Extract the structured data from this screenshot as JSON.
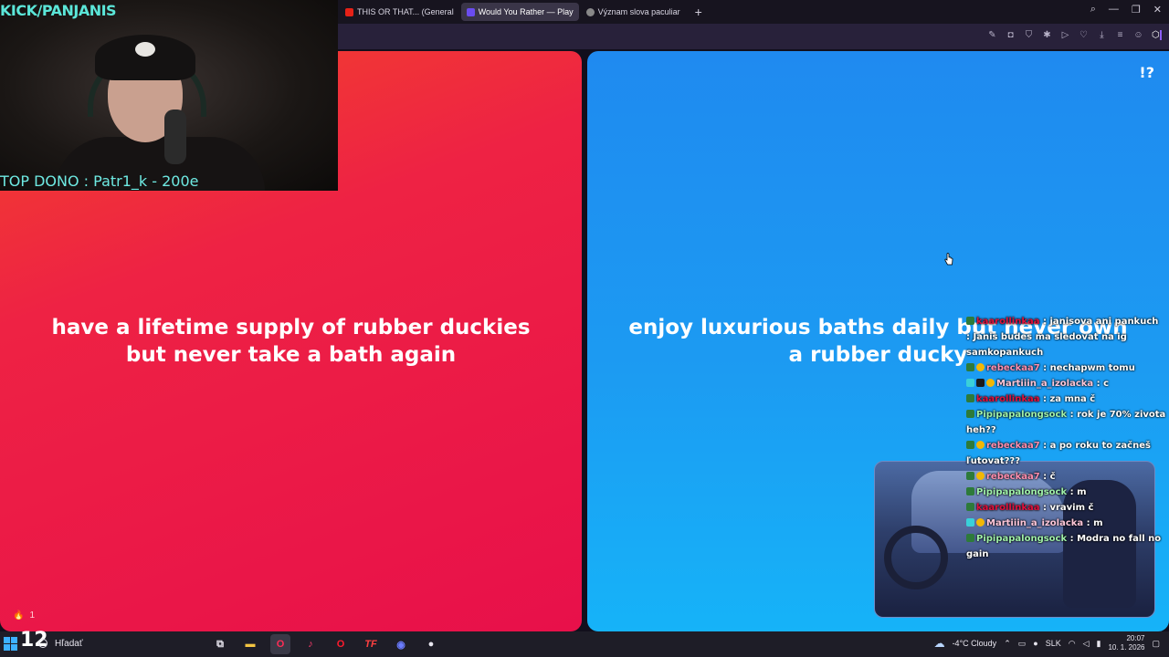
{
  "browser": {
    "tabs": [
      {
        "label": "THIS OR THAT... (General",
        "fav_color": "#e62117",
        "active": false
      },
      {
        "label": "Would You Rather — Play",
        "fav_color": "#6a4cf0",
        "active": true
      },
      {
        "label": "Význam slova paculiar",
        "fav_color": "#888888",
        "active": false
      }
    ],
    "new_tab": "+",
    "window_controls": [
      "⌕",
      "—",
      "❐",
      "✕"
    ]
  },
  "game": {
    "option_a": "have a lifetime supply of rubber duckies but never take a bath again",
    "option_b": "enjoy luxurious baths daily but never own a rubber ducky",
    "logo": "!?",
    "likes": "1",
    "colors": {
      "red": "#ee2244",
      "blue": "#1c9bf2"
    }
  },
  "stream": {
    "channel": "KICK/PANJANIS",
    "top_dono": "TOP DONO : Patr1_k - 200e"
  },
  "chat": [
    {
      "user": "kaarollinkaa",
      "user_color": "#e0113c",
      "text": " : janisova ani pankuch",
      "user_color2": "#ff8c1a"
    },
    {
      "user": "",
      "user_color": "#ffffff",
      "text": ": Janis budes ma sledovat na ig samkopankuch"
    },
    {
      "user": "rebeckaa7",
      "user_color": "#ff8fb0",
      "text": " : nechapwm tomu"
    },
    {
      "user": "Martiiin_a_izolacka",
      "user_color": "#ffc7da",
      "text": " : c"
    },
    {
      "user": "kaarollinkaa",
      "user_color": "#e0113c",
      "text": " : za mna č"
    },
    {
      "user": "Pipipapalongsock",
      "user_color": "#9ff0a8",
      "text": " : rok je 70% zivota heh??"
    },
    {
      "user": "rebeckaa7",
      "user_color": "#ff8fb0",
      "text": " : a po roku to začneš ľutovat???"
    },
    {
      "user": "rebeckaa7",
      "user_color": "#ff8fb0",
      "text": " : č"
    },
    {
      "user": "Pipipapalongsock",
      "user_color": "#9ff0a8",
      "text": " : m"
    },
    {
      "user": "kaarollinkaa",
      "user_color": "#e0113c",
      "text": " : vravim č"
    },
    {
      "user": "Martiiin_a_izolacka",
      "user_color": "#ffc7da",
      "text": " : m"
    },
    {
      "user": "Pipipapalongsock",
      "user_color": "#9ff0a8",
      "text": " : Modra no fall no gain"
    }
  ],
  "taskbar": {
    "big_number": "12",
    "search": "Hľadať",
    "apps": [
      {
        "name": "task-view",
        "glyph": "⧉",
        "color": "#e8e6ef"
      },
      {
        "name": "file-explorer",
        "glyph": "▬",
        "color": "#f4c542"
      },
      {
        "name": "opera-gx",
        "glyph": "O",
        "color": "#ff2d55"
      },
      {
        "name": "tiktok",
        "glyph": "♪",
        "color": "#ff3b6b"
      },
      {
        "name": "opera",
        "glyph": "O",
        "color": "#ff1b2d"
      },
      {
        "name": "tf-app",
        "glyph": "TF",
        "color": "#ff4040"
      },
      {
        "name": "discord",
        "glyph": "◉",
        "color": "#6b7cff"
      },
      {
        "name": "obs",
        "glyph": "●",
        "color": "#e8e6ef"
      }
    ],
    "weather": "-4°C  Cloudy",
    "language": "SLK",
    "time": "20:07",
    "date": "10. 1. 2026"
  }
}
